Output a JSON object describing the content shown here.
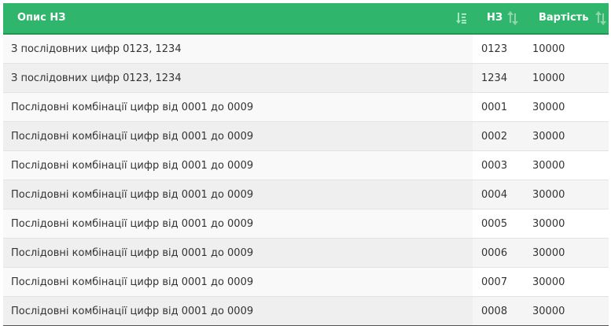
{
  "table": {
    "headers": {
      "description": "Опис НЗ",
      "number": "НЗ",
      "price": "Вартість"
    },
    "rows": [
      {
        "description": "З послідовних цифр 0123, 1234",
        "number": "0123",
        "price": "10000"
      },
      {
        "description": "З послідовних цифр 0123, 1234",
        "number": "1234",
        "price": "10000"
      },
      {
        "description": "Послідовні комбінації цифр від 0001 до 0009",
        "number": "0001",
        "price": "30000"
      },
      {
        "description": "Послідовні комбінації цифр від 0001 до 0009",
        "number": "0002",
        "price": "30000"
      },
      {
        "description": "Послідовні комбінації цифр від 0001 до 0009",
        "number": "0003",
        "price": "30000"
      },
      {
        "description": "Послідовні комбінації цифр від 0001 до 0009",
        "number": "0004",
        "price": "30000"
      },
      {
        "description": "Послідовні комбінації цифр від 0001 до 0009",
        "number": "0005",
        "price": "30000"
      },
      {
        "description": "Послідовні комбінації цифр від 0001 до 0009",
        "number": "0006",
        "price": "30000"
      },
      {
        "description": "Послідовні комбінації цифр від 0001 до 0009",
        "number": "0007",
        "price": "30000"
      },
      {
        "description": "Послідовні комбінації цифр від 0001 до 0009",
        "number": "0008",
        "price": "30000"
      }
    ]
  },
  "icons": {
    "description_sort": "sort-active-icon",
    "number_sort": "sort-both-icon",
    "price_sort": "sort-both-icon"
  },
  "colors": {
    "header_bg": "#2fb56c",
    "header_text": "#ffffff",
    "sort_icon": "#9be0b8"
  }
}
